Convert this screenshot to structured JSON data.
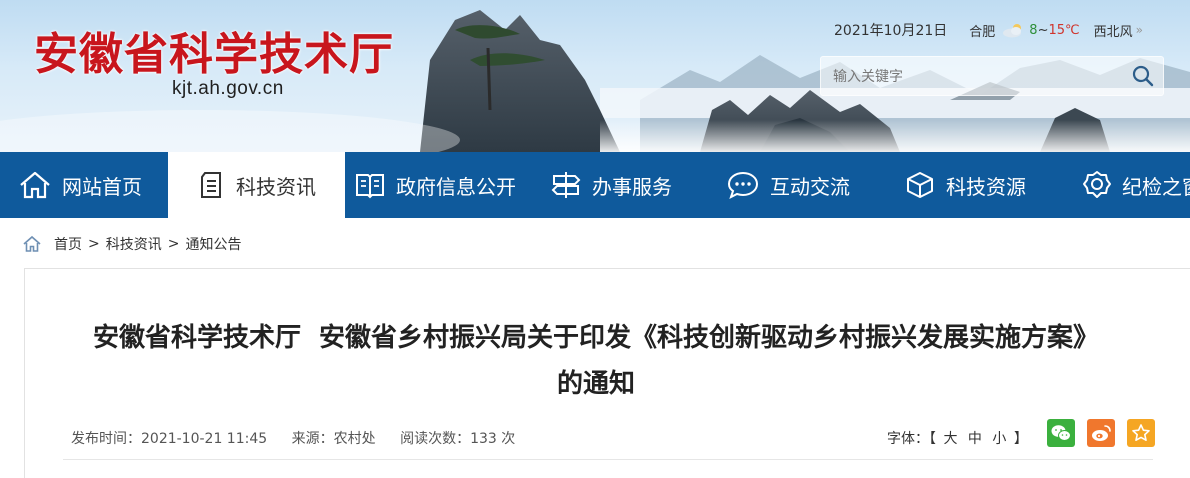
{
  "header": {
    "site_title": "安徽省科学技术厅",
    "domain": "kjt.ah.gov.cn",
    "date": "2021年10月21日",
    "city": "合肥",
    "temp_low": "8",
    "temp_sep": "~",
    "temp_high": "15℃",
    "wind": "西北风",
    "search_placeholder": "输入关键字"
  },
  "nav": {
    "items": [
      {
        "label": "网站首页",
        "icon": "home-icon"
      },
      {
        "label": "科技资讯",
        "icon": "document-icon",
        "active": true
      },
      {
        "label": "政府信息公开",
        "icon": "book-icon"
      },
      {
        "label": "办事服务",
        "icon": "signpost-icon"
      },
      {
        "label": "互动交流",
        "icon": "chat-icon"
      },
      {
        "label": "科技资源",
        "icon": "cube-icon"
      },
      {
        "label": "纪检之窗",
        "icon": "badge-icon"
      }
    ]
  },
  "breadcrumb": {
    "home": "首页",
    "sep": ">",
    "level1": "科技资讯",
    "level2": "通知公告"
  },
  "article": {
    "title_line1": "安徽省科学技术厅  安徽省乡村振兴局关于印发《科技创新驱动乡村振兴发展实施方案》",
    "title_line2": "的通知",
    "publish_time": "发布时间：2021-10-21 11:45",
    "source": "来源：农村处",
    "views": "阅读次数：133 次",
    "font_label": "字体：【",
    "font_large": "大",
    "font_medium": "中",
    "font_small": "小",
    "font_end": "】"
  },
  "colors": {
    "nav_bg": "#0f5a9c",
    "title_red": "#c8161d",
    "wechat": "#3bb03e",
    "weibo": "#f0772d",
    "favorite": "#f5a623"
  }
}
